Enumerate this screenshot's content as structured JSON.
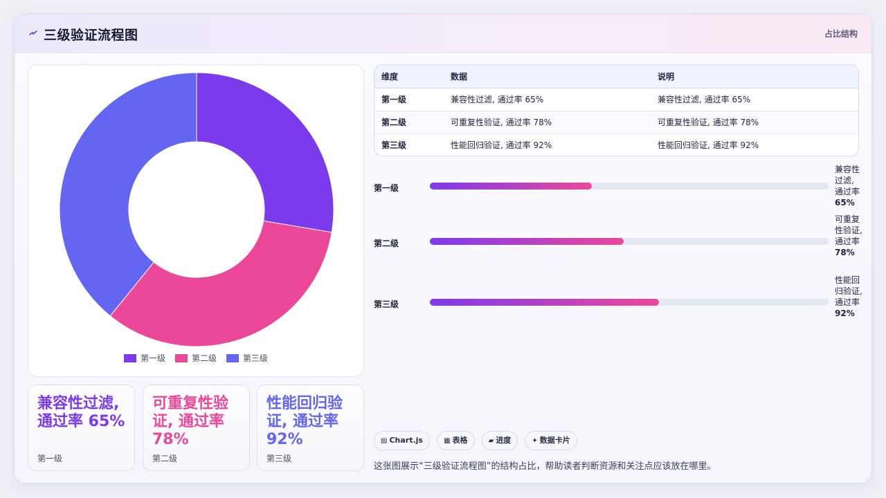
{
  "header": {
    "title": "三级验证流程图",
    "badge": "占比结构"
  },
  "chart_data": {
    "type": "pie",
    "categories": [
      "第一级",
      "第二级",
      "第三级"
    ],
    "values": [
      65,
      78,
      92
    ],
    "descriptions": [
      "兼容性过滤, 通过率 65%",
      "可重复性验证, 通过率 78%",
      "性能回归验证, 通过率 92%"
    ],
    "colors": [
      "#7c3aed",
      "#ec4899",
      "#6366f1"
    ],
    "legend": [
      "第一级",
      "第二级",
      "第三级"
    ],
    "legend_position": "bottom"
  },
  "stats": [
    {
      "value": "兼容性过滤, 通过率 65%",
      "label": "第一级",
      "color": "#7c3aed"
    },
    {
      "value": "可重复性验证, 通过率 78%",
      "label": "第二级",
      "color": "#ec4899"
    },
    {
      "value": "性能回归验证, 通过率 92%",
      "label": "第三级",
      "color": "#6366f1"
    }
  ],
  "table": {
    "headers": [
      "维度",
      "数据",
      "说明"
    ],
    "rows": [
      [
        "第一级",
        "兼容性过滤, 通过率 65%",
        "兼容性过滤, 通过率 65%"
      ],
      [
        "第二级",
        "可重复性验证, 通过率 78%",
        "可重复性验证, 通过率 78%"
      ],
      [
        "第三级",
        "性能回归验证, 通过率 92%",
        "性能回归验证, 通过率 92%"
      ]
    ]
  },
  "progress": [
    {
      "label": "第一级",
      "text": "兼容性过滤, 通过率",
      "num": "65%",
      "fraction": 0.406
    },
    {
      "label": "第二级",
      "text": "可重复性验证, 通过率",
      "num": "78%",
      "fraction": 0.486
    },
    {
      "label": "第三级",
      "text": "性能回归验证, 通过率",
      "num": "92%",
      "fraction": 0.574
    }
  ],
  "chips": [
    {
      "icon": "▤",
      "label": "Chart.js",
      "icon_name": "chart-icon"
    },
    {
      "icon": "▦",
      "label": "表格",
      "icon_name": "table-icon"
    },
    {
      "icon": "▰",
      "label": "进度",
      "icon_name": "progress-icon"
    },
    {
      "icon": "✦",
      "label": "数据卡片",
      "icon_name": "sparkle-icon"
    }
  ],
  "description": "这张图展示“三级验证流程图”的结构占比，帮助读者判断资源和关注点应该放在哪里。"
}
